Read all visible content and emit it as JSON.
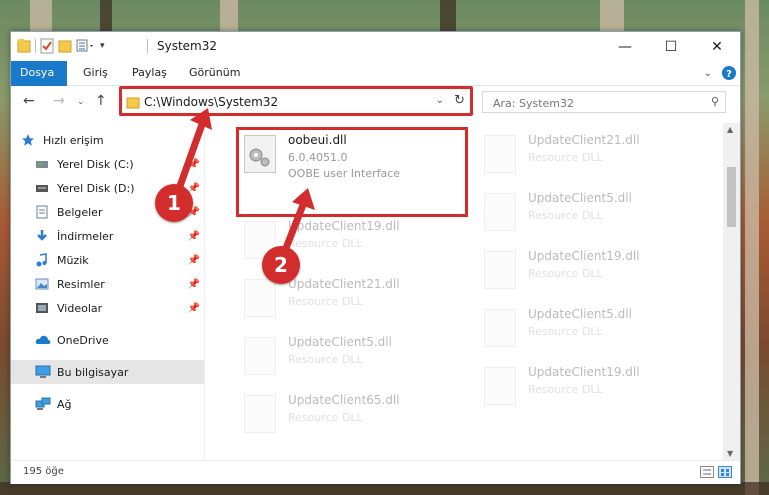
{
  "window": {
    "title": "System32",
    "minimize": "—",
    "maximize": "☐",
    "close": "✕"
  },
  "ribbon": {
    "tabs": [
      "Dosya",
      "Giriş",
      "Paylaş",
      "Görünüm"
    ]
  },
  "address": {
    "path": "C:\\Windows\\System32"
  },
  "search": {
    "placeholder": "Ara: System32"
  },
  "sidebar": {
    "items": [
      {
        "label": "Hızlı erişim",
        "icon": "star-icon"
      },
      {
        "label": "Yerel Disk (C:)",
        "icon": "drive-icon"
      },
      {
        "label": "Yerel Disk (D:)",
        "icon": "drive-icon"
      },
      {
        "label": "Belgeler",
        "icon": "documents-icon"
      },
      {
        "label": "İndirmeler",
        "icon": "download-icon"
      },
      {
        "label": "Müzik",
        "icon": "music-icon"
      },
      {
        "label": "Resimler",
        "icon": "pictures-icon"
      },
      {
        "label": "Videolar",
        "icon": "videos-icon"
      },
      {
        "label": "OneDrive",
        "icon": "cloud-icon"
      },
      {
        "label": "Bu bilgisayar",
        "icon": "computer-icon"
      },
      {
        "label": "Ağ",
        "icon": "network-icon"
      }
    ]
  },
  "files": {
    "highlight": {
      "name": "oobeui.dll",
      "version": "6.0.4051.0",
      "desc": "OOBE user Interface"
    },
    "ghost": [
      {
        "name": "UpdateClient21.dll",
        "desc": "Resource DLL"
      },
      {
        "name": "UpdateClient19.dll",
        "desc": "Resource DLL"
      },
      {
        "name": "UpdateClient5.dll",
        "desc": "Resource DLL"
      },
      {
        "name": "UpdateClient21.dll",
        "desc": "Resource DLL"
      },
      {
        "name": "UpdateClient19.dll",
        "desc": "Resource DLL"
      },
      {
        "name": "UpdateClient5.dll",
        "desc": "Resource DLL"
      },
      {
        "name": "UpdateClient5.dll",
        "desc": "Resource DLL"
      },
      {
        "name": "UpdateClient65.dll",
        "desc": "Resource DLL"
      },
      {
        "name": "UpdateClient19.dll",
        "desc": "Resource DLL"
      }
    ]
  },
  "annotations": {
    "step1": "1",
    "step2": "2"
  },
  "status": {
    "count": "195 öğe"
  },
  "colors": {
    "accent": "#1979ca",
    "highlight": "#d22c2c"
  }
}
